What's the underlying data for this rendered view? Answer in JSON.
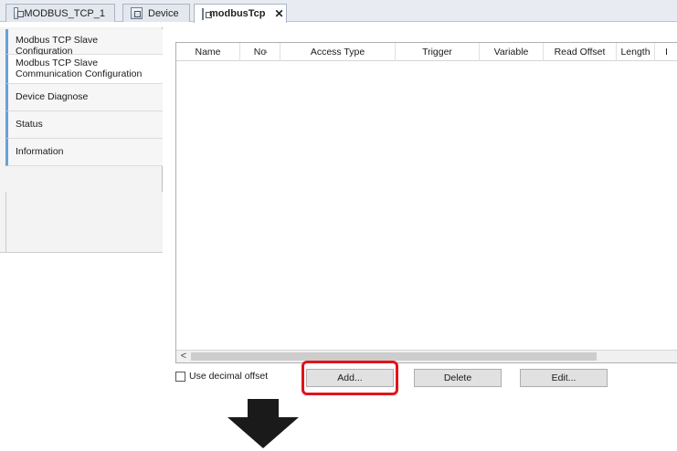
{
  "tabs": [
    {
      "label": "MODBUS_TCP_1",
      "active": false
    },
    {
      "label": "Device",
      "active": false
    },
    {
      "label": "modbusTcp",
      "active": true,
      "close": "✕"
    }
  ],
  "sidebar": {
    "items": [
      {
        "label": "Modbus TCP Slave Configuration"
      },
      {
        "label": "Modbus TCP Slave Communication Configuration",
        "selected": true
      },
      {
        "label": "Device Diagnose"
      },
      {
        "label": "Status"
      },
      {
        "label": "Information"
      }
    ]
  },
  "table": {
    "columns": [
      "Name",
      "No",
      "Access Type",
      "Trigger",
      "Variable",
      "Read Offset",
      "Length",
      "I"
    ],
    "rows": []
  },
  "scroll_left": "<",
  "options": {
    "use_decimal_offset_label": "Use decimal offset",
    "use_decimal_offset_checked": false
  },
  "buttons": {
    "add": "Add...",
    "delete": "Delete",
    "edit": "Edit..."
  },
  "colors": {
    "highlight": "#e0141b",
    "arrow": "#1a1a1a",
    "sidebar_accent": "#6a9fd8"
  }
}
